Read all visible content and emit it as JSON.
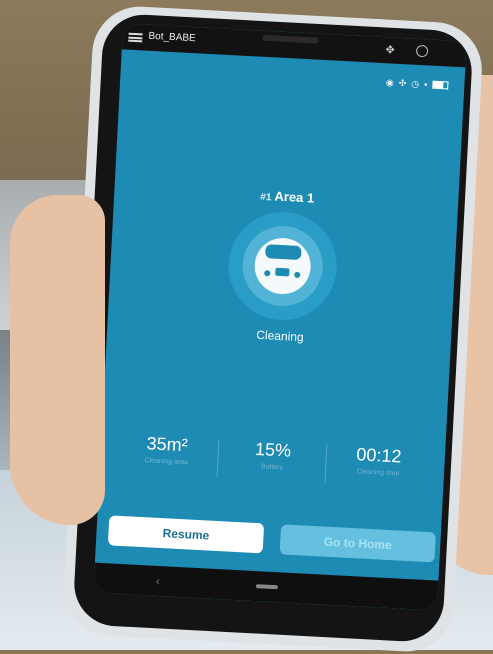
{
  "app": {
    "title": "Bot_BABE"
  },
  "status_bar": {
    "icons": [
      "eye-icon",
      "fan-icon",
      "timer-icon",
      "signal-icon",
      "battery-icon"
    ]
  },
  "robot": {
    "area_prefix": "#1",
    "area_name": "Area 1",
    "status": "Cleaning"
  },
  "stats": [
    {
      "value": "35m²",
      "label": "Cleaning area"
    },
    {
      "value": "15%",
      "label": "Battery"
    },
    {
      "value": "00:12",
      "label": "Cleaning time"
    }
  ],
  "actions": {
    "resume_label": "Resume",
    "home_label": "Go to Home"
  },
  "colors": {
    "screen": "#1e8bb4",
    "button_primary": "#ffffff",
    "button_secondary": "#64c0de"
  }
}
